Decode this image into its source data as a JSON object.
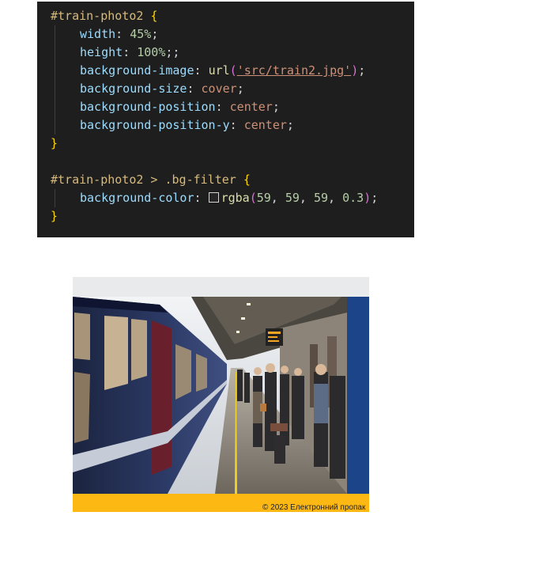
{
  "code": {
    "block1": {
      "selector": "#train-photo2",
      "open": "{",
      "close": "}",
      "width_prop": "width",
      "width_val": "45%",
      "height_prop": "height",
      "height_val": "100%",
      "height_extra": ";",
      "bgimg_prop": "background-image",
      "bgimg_fn": "url",
      "bgimg_str": "'src/train2.jpg'",
      "bgsize_prop": "background-size",
      "bgsize_val": "cover",
      "bgpos_prop": "background-position",
      "bgpos_val": "center",
      "bgposy_prop": "background-position-y",
      "bgposy_val": "center"
    },
    "block2": {
      "selector": "#train-photo2 > .bg-filter",
      "open": "{",
      "close": "}",
      "bgcolor_prop": "background-color",
      "rgba_fn": "rgba",
      "rgba_r": "59",
      "rgba_g": "59",
      "rgba_b": "59",
      "rgba_a": "0.3",
      "swatch_color": "#3b3b3b"
    }
  },
  "preview": {
    "footer_text": "© 2023 Електронний пропак",
    "header_color": "#e9eaec",
    "side_color": "#1b4588",
    "footer_color": "#fdb813"
  }
}
